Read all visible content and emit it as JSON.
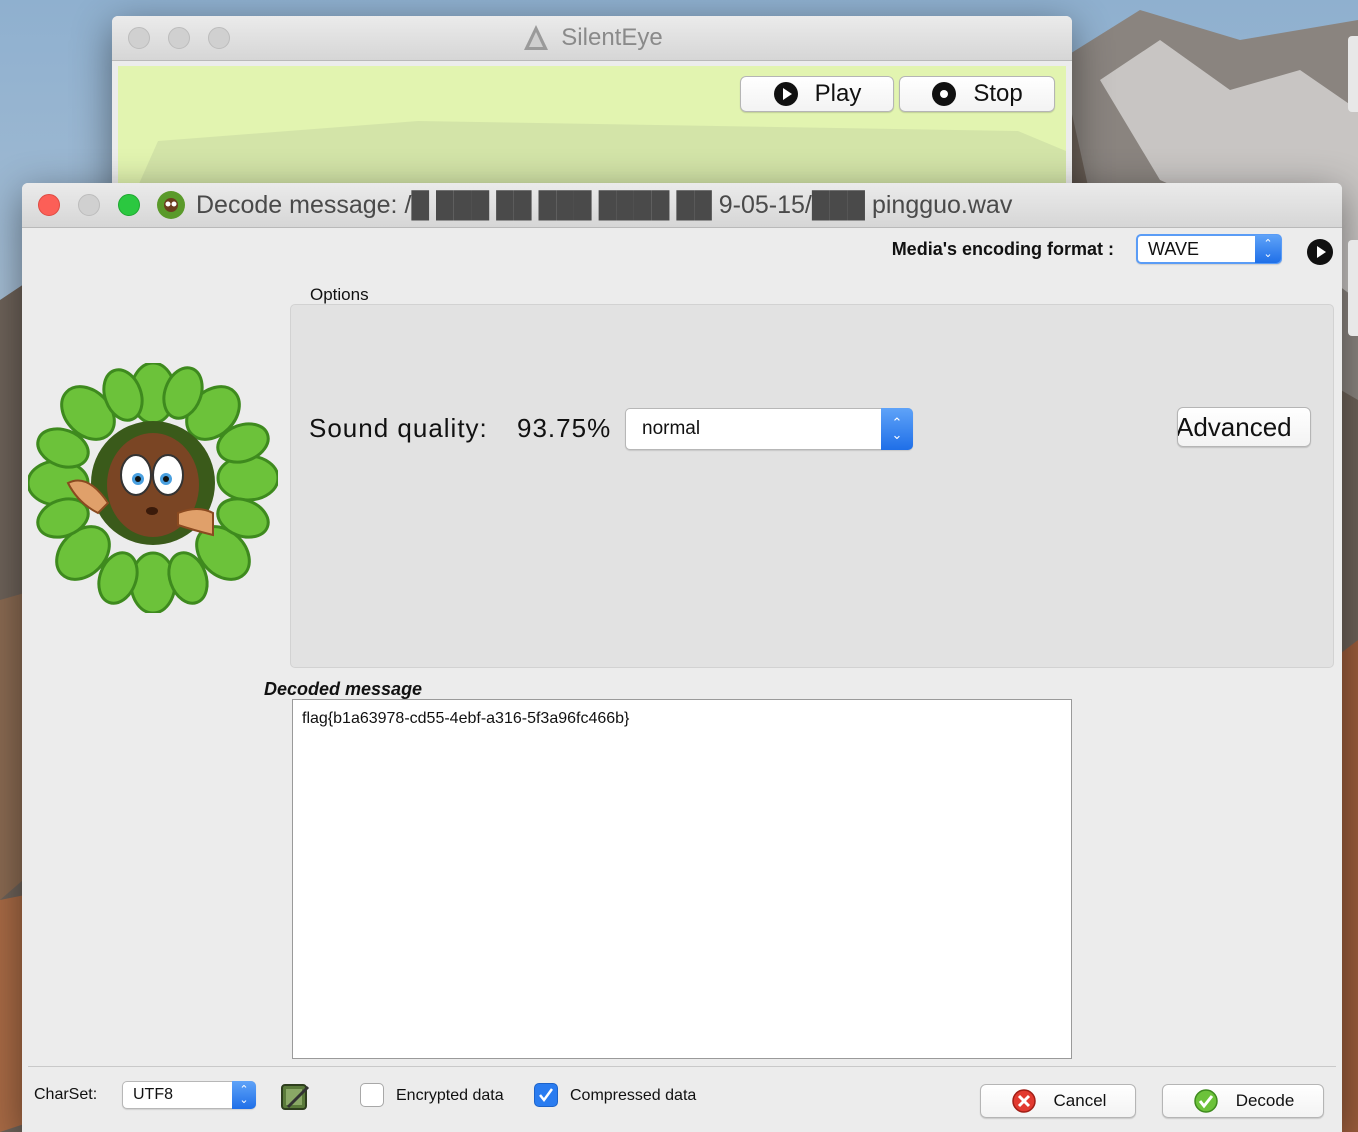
{
  "back_window": {
    "title": "SilentEye",
    "play_label": "Play",
    "stop_label": "Stop"
  },
  "dialog": {
    "title": "Decode message: /█ ███ ██ ███ ████ ██ 9-05-15/███ pingguo.wav",
    "encoding_format_label": "Media's encoding format :",
    "encoding_format_value": "WAVE",
    "options_label": "Options",
    "sound_quality_label": "Sound quality:",
    "sound_quality_value": "93.75%",
    "quality_mode": "normal",
    "advanced_label": "Advanced",
    "decoded_message_label": "Decoded message",
    "decoded_message": "flag{b1a63978-cd55-4ebf-a316-5f3a96fc466b}",
    "charset_label": "CharSet:",
    "charset_value": "UTF8",
    "encrypted_label": "Encrypted data",
    "encrypted_checked": false,
    "compressed_label": "Compressed data",
    "compressed_checked": true,
    "cancel_label": "Cancel",
    "decode_label": "Decode"
  },
  "colors": {
    "accent": "#2a7cf0",
    "back_window_bg": "#e2f4b0",
    "panel_bg": "#e2e2e2"
  }
}
